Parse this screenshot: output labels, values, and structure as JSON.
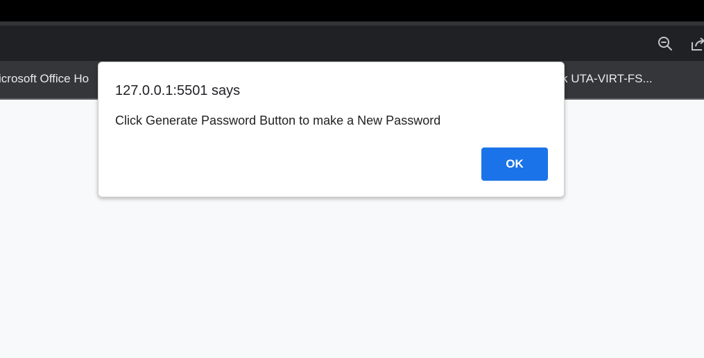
{
  "browser": {
    "toolbar": {
      "icons": [
        "zoom-out-icon",
        "share-icon"
      ]
    },
    "bookmarks": {
      "items": [
        {
          "label": "icrosoft Office Ho"
        },
        {
          "label": "k  UTA-VIRT-FS..."
        }
      ]
    }
  },
  "dialog": {
    "title": "127.0.0.1:5501 says",
    "message": "Click Generate Password Button to make a New Password",
    "ok_label": "OK"
  },
  "colors": {
    "accent": "#1a73e8",
    "toolbar_bg": "#202124",
    "bookmarks_bg": "#35363a",
    "page_bg": "#f8f9fa"
  }
}
